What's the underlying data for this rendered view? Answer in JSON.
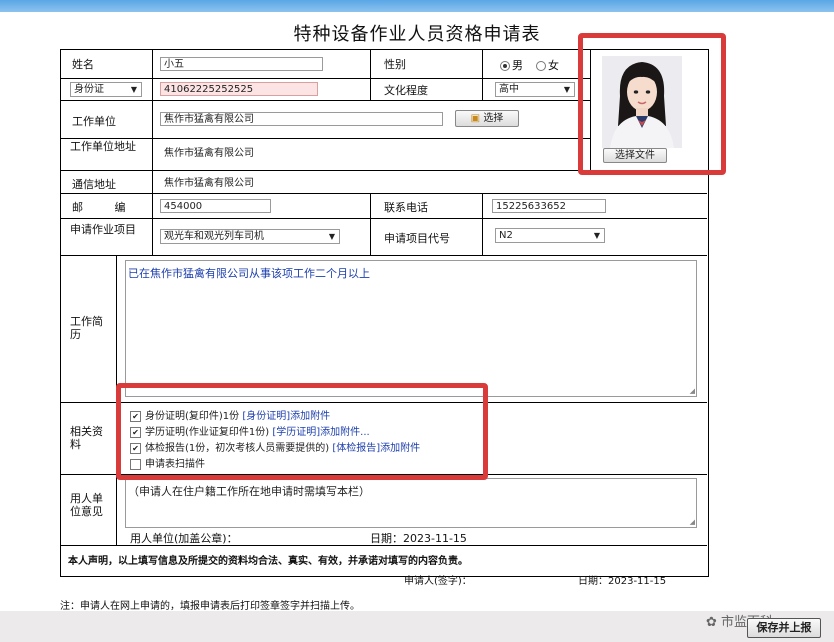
{
  "form": {
    "title": "特种设备作业人员资格申请表",
    "labels": {
      "name": "姓名",
      "gender": "性别",
      "education": "文化程度",
      "work_unit": "工作单位",
      "unit_address": "工作单位地址",
      "mail_address": "通信地址",
      "postcode": "邮 编",
      "phone": "联系电话",
      "work_item": "申请作业项目",
      "item_code": "申请项目代号",
      "resume": "工作简历",
      "materials": "相关资料",
      "employer_opinion": "用人单位意见"
    },
    "values": {
      "name": "小五",
      "id_type": "身份证",
      "id_number": "41062225252525",
      "gender_male": "男",
      "gender_female": "女",
      "education": "高中",
      "work_unit": "焦作市猛禽有限公司",
      "select_button": "选择",
      "unit_address": "焦作市猛禽有限公司",
      "mail_address": "焦作市猛禽有限公司",
      "postcode": "454000",
      "phone": "15225633652",
      "work_item": "观光车和观光列车司机",
      "item_code": "N2",
      "resume_text": "已在焦作市猛禽有限公司从事该项工作二个月以上",
      "opinion_text": "（申请人在住户籍工作所在地申请时需填写本栏）",
      "unit_seal": "用人单位(加盖公章)：",
      "date1": "日期：2023-11-15",
      "declaration": "本人声明，以上填写信息及所提交的资料均合法、真实、有效，并承诺对填写的内容负责。",
      "applicant_sign": "申请人(签字)：",
      "date2": "日期：2023-11-15",
      "footnote": "注：申请人在网上申请的，填报申请表后打印签章签字并扫描上传。",
      "choose_file": "选择文件"
    },
    "materials": [
      {
        "text": "身份证明(复印件)1份",
        "link": "[身份证明]添加附件",
        "checked": true
      },
      {
        "text": "学历证明(作业证复印件1份)",
        "link": "[学历证明]添加附件...",
        "checked": true
      },
      {
        "text": "体检报告(1份，初次考核人员需要提供的)",
        "link": "[体检报告]添加附件",
        "checked": true
      },
      {
        "text": "申请表扫描件",
        "link": "",
        "checked": false
      }
    ],
    "submit": "保存并上报",
    "watermark": "市监百科"
  }
}
